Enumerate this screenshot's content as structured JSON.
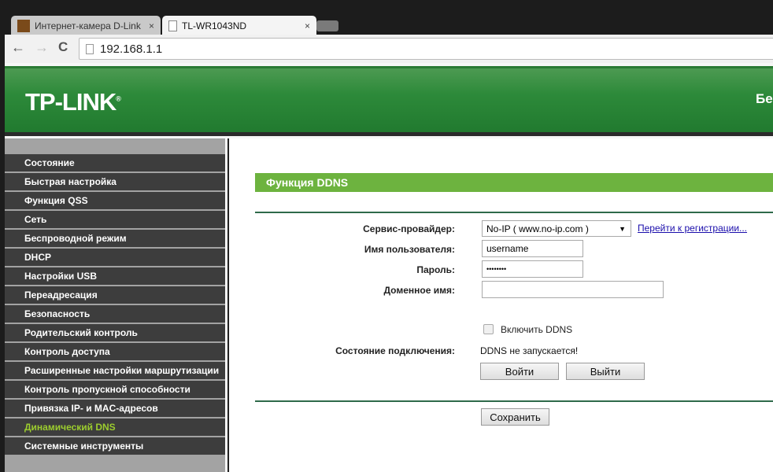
{
  "browser": {
    "tabs": [
      {
        "label": "Интернет-камера D-Link",
        "close": "×"
      },
      {
        "label": "TL-WR1043ND",
        "close": "×"
      }
    ],
    "url": "192.168.1.1",
    "nav": {
      "back": "←",
      "forward": "→",
      "reload": "C"
    }
  },
  "header": {
    "logo": "TP-LINK",
    "logo_mark": "®",
    "right_text": "Бе"
  },
  "sidebar": {
    "items": [
      "Состояние",
      "Быстрая настройка",
      "Функция QSS",
      "Сеть",
      "Беспроводной режим",
      "DHCP",
      "Настройки USB",
      "Переадресация",
      "Безопасность",
      "Родительский контроль",
      "Контроль доступа",
      "Расширенные настройки маршрутизации",
      "Контроль пропускной способности",
      "Привязка IP- и MAC-адресов",
      "Динамический DNS",
      "Системные инструменты"
    ],
    "active_index": 14,
    "active_color": "#9ccd2e"
  },
  "main": {
    "title": "Функция DDNS",
    "provider_label": "Сервис-провайдер:",
    "provider_value": "No-IP ( www.no-ip.com )",
    "register_link": "Перейти к регистрации...",
    "username_label": "Имя пользователя:",
    "username_value": "username",
    "password_label": "Пароль:",
    "password_value": "••••••••",
    "domain_label": "Доменное имя:",
    "domain_value": "",
    "enable_label": "Включить DDNS",
    "enable_checked": false,
    "status_label": "Состояние подключения:",
    "status_value": "DDNS не запускается!",
    "login_button": "Войти",
    "logout_button": "Выйти",
    "save_button": "Сохранить"
  }
}
